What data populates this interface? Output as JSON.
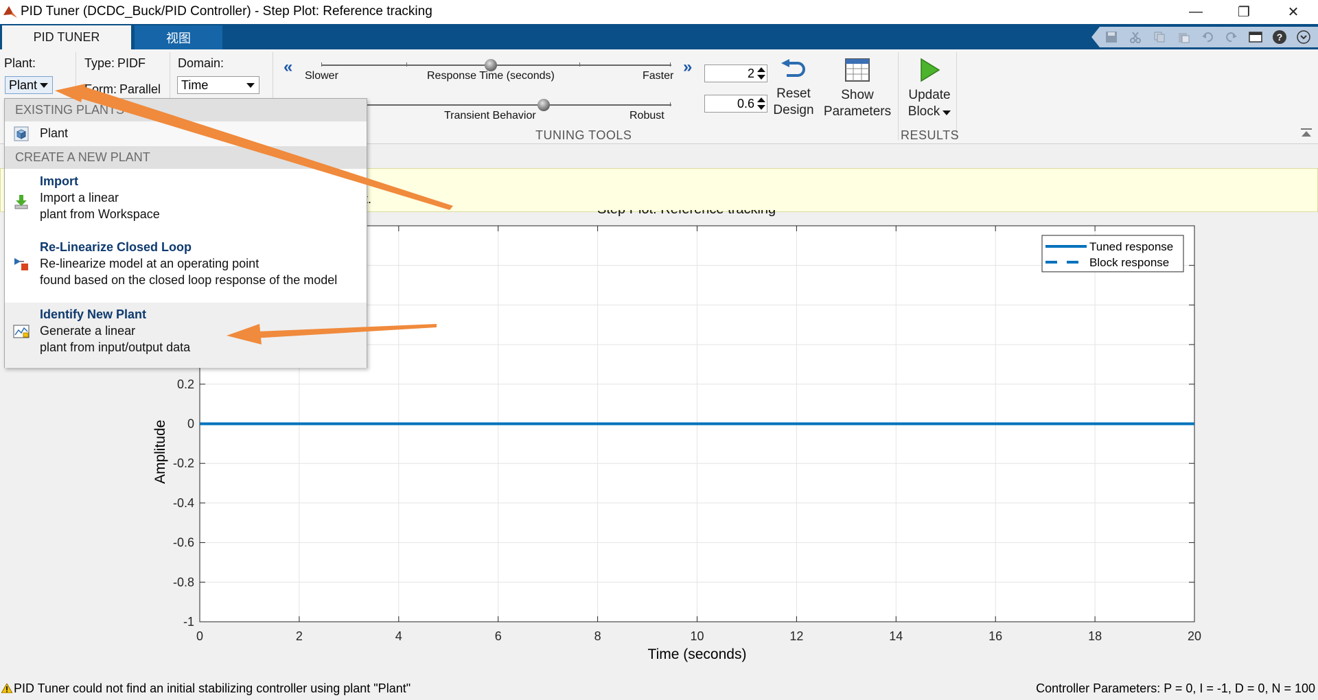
{
  "window": {
    "title": "PID Tuner (DCDC_Buck/PID Controller) - Step Plot: Reference tracking",
    "minimize": "—",
    "restore": "❐",
    "close": "✕"
  },
  "tabs": [
    {
      "label": "PID TUNER",
      "active": true
    },
    {
      "label": "视图",
      "active": false
    }
  ],
  "ribbon": {
    "plant_label": "Plant:",
    "plant_value": "Plant",
    "type_label": "Type:",
    "type_value": "PIDF",
    "form_label": "Form:",
    "form_value": "Parallel",
    "domain_label": "Domain:",
    "domain_value": "Time",
    "slider1": {
      "left": "Slower",
      "center": "Response Time (seconds)",
      "right": "Faster",
      "value": 2
    },
    "slider2": {
      "center": "Transient Behavior",
      "right": "Robust",
      "value": 0.6
    },
    "spin1_value": "2",
    "spin2_value": "0.6",
    "reset_line1": "Reset",
    "reset_line2": "Design",
    "show_line1": "Show",
    "show_line2": "Parameters",
    "update_line1": "Update",
    "update_line2": "Block",
    "tuning_tools_label": "TUNING TOOLS",
    "results_label": "RESULTS"
  },
  "infobar": {
    "text": "t."
  },
  "plot": {
    "title_partial": "Step Plot: Reference tracking"
  },
  "chart_data": {
    "type": "line",
    "title": "Step Plot: Reference tracking",
    "xlabel": "Time (seconds)",
    "ylabel": "Amplitude",
    "xlim": [
      0,
      20
    ],
    "ylim": [
      -1,
      1
    ],
    "xticks": [
      "0",
      "2",
      "4",
      "6",
      "8",
      "10",
      "12",
      "14",
      "16",
      "18",
      "20"
    ],
    "yticks": [
      "-1",
      "-0.8",
      "-0.6",
      "-0.4",
      "-0.2",
      "0",
      "0.2"
    ],
    "grid": true,
    "legend_position": "top-right",
    "series": [
      {
        "name": "Tuned response",
        "style": "solid",
        "x": [
          0,
          20
        ],
        "y": [
          0,
          0
        ]
      },
      {
        "name": "Block response",
        "style": "dashed",
        "x": [],
        "y": []
      }
    ],
    "color": "#0072bd"
  },
  "menu": {
    "existing_header": "EXISTING PLANTS",
    "existing_item": "Plant",
    "create_header": "CREATE A NEW PLANT",
    "items": [
      {
        "title": "Import",
        "lines": [
          "Import a linear",
          "plant from Workspace"
        ]
      },
      {
        "title": "Re-Linearize Closed Loop",
        "lines": [
          "Re-linearize model at an operating point",
          "found based on the closed loop response of the model"
        ]
      },
      {
        "title": "Identify New Plant",
        "lines": [
          "Generate a linear",
          "plant from input/output data"
        ]
      }
    ]
  },
  "status": {
    "left": "PID Tuner could not find an initial stabilizing controller using plant \"Plant\"",
    "right": "Controller Parameters: P =  0, I = -1, D =  0, N = 100"
  },
  "colors": {
    "accent": "#0a4f87",
    "arrow": "#f08a3c",
    "line": "#0072bd"
  }
}
